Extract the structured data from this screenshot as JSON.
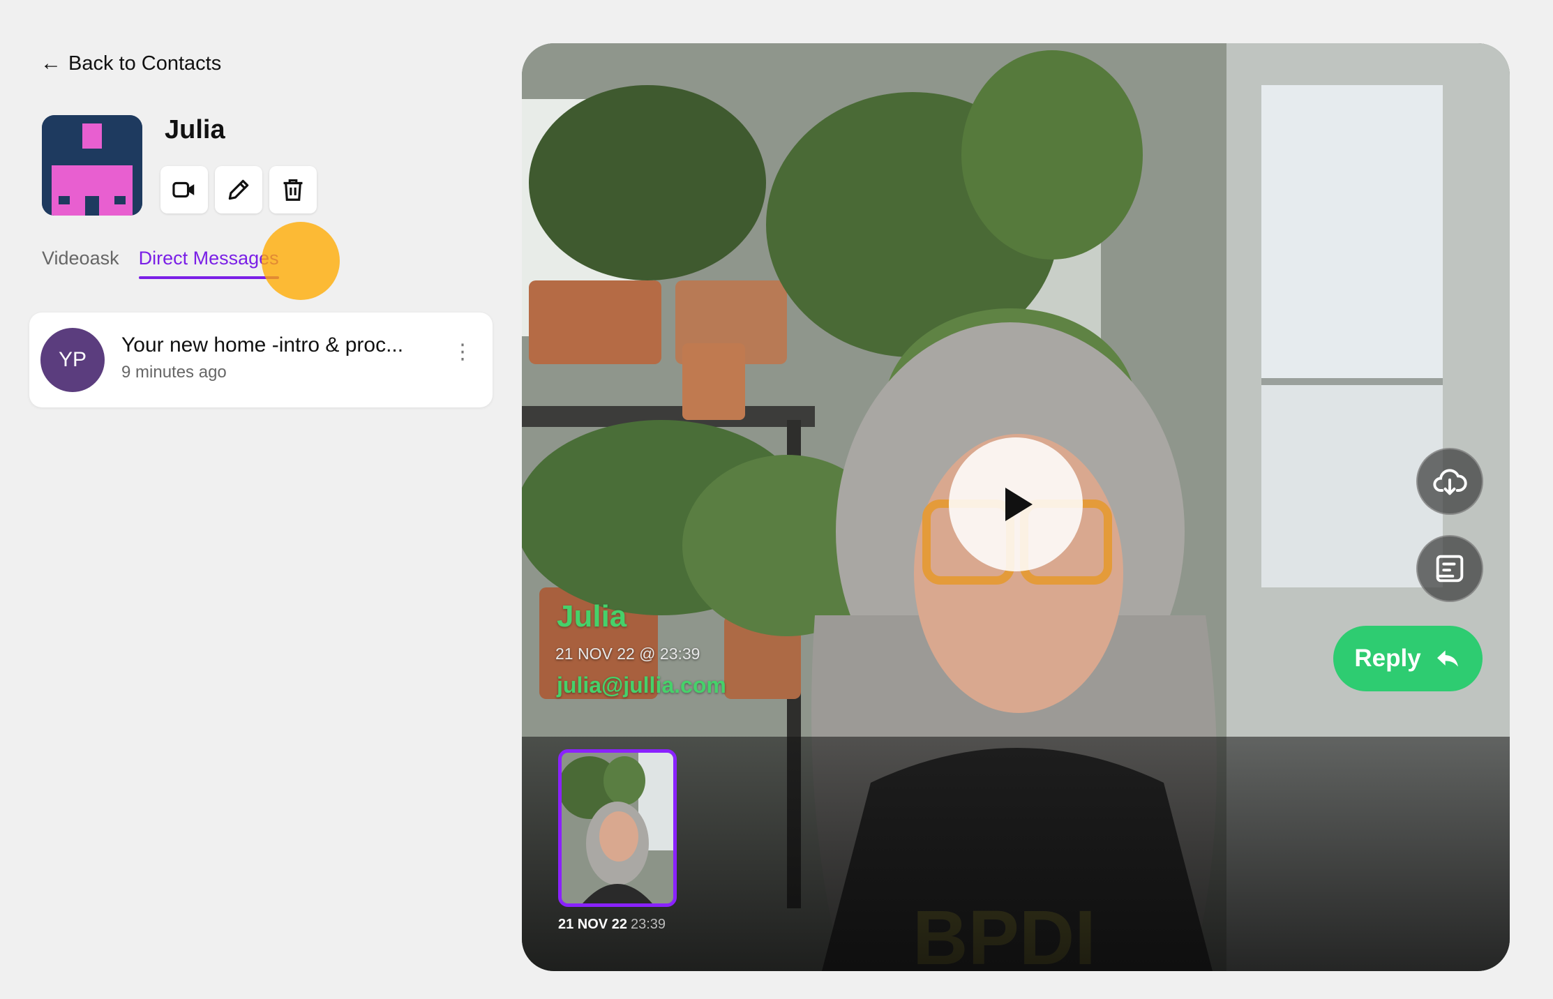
{
  "nav": {
    "back_label": "Back to Contacts"
  },
  "contact": {
    "name": "Julia"
  },
  "actions": [
    {
      "name": "video-icon"
    },
    {
      "name": "pencil-icon"
    },
    {
      "name": "trash-icon"
    }
  ],
  "tabs": [
    {
      "label": "Videoask",
      "active": false
    },
    {
      "label": "Direct Messages",
      "active": true
    }
  ],
  "messages": [
    {
      "initials": "YP",
      "title": "Your new home -intro & proc...",
      "time": "9 minutes ago"
    }
  ],
  "video": {
    "sender_name": "Julia",
    "date": "21 NOV 22 @ 23:39",
    "email": "julia@jullia.com",
    "reply_label": "Reply",
    "thumbnail": {
      "date": "21 NOV 22",
      "time": "23:39"
    }
  },
  "colors": {
    "accent": "#7a1fe6",
    "reply_green": "#2ecc71",
    "name_green": "#46d16a",
    "highlight": "#ffaa00",
    "avatar_purple": "#5b3d7e"
  }
}
